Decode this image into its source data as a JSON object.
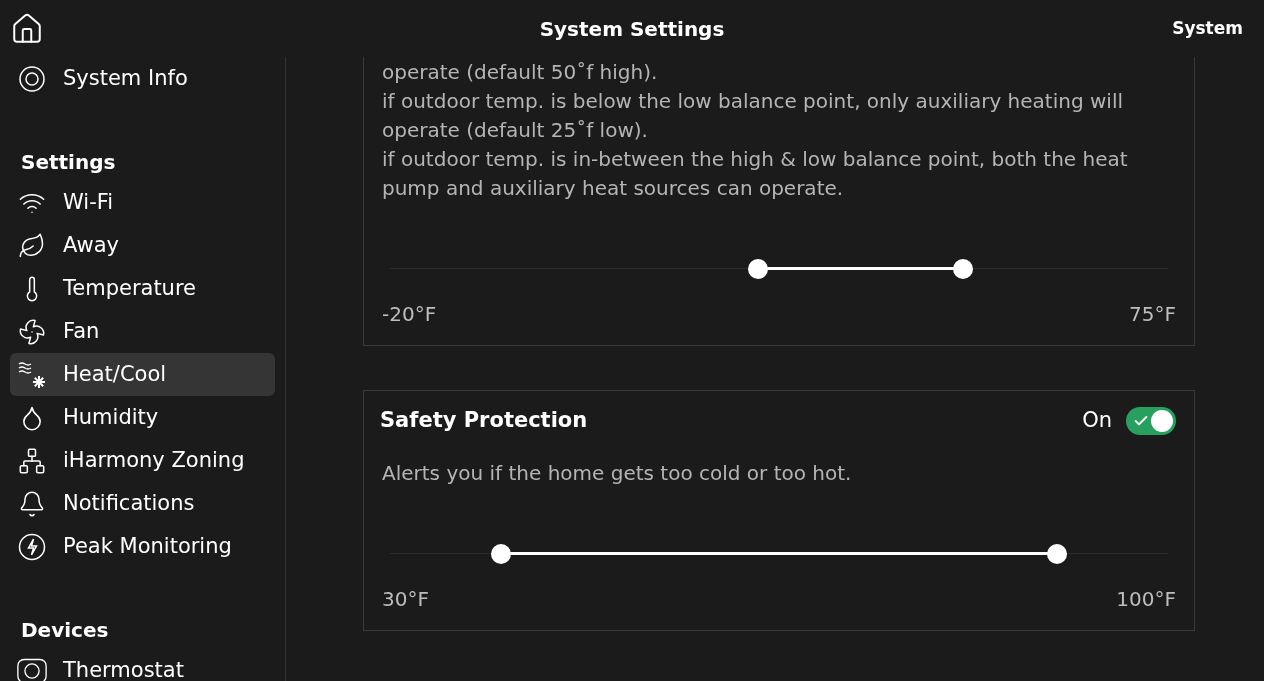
{
  "header": {
    "title": "System Settings",
    "context": "System"
  },
  "sidebar": {
    "top_items": [
      {
        "label": "System Info",
        "kind": "info",
        "selected": false
      }
    ],
    "sections": [
      {
        "title": "Settings",
        "items": [
          {
            "label": "Wi-Fi",
            "kind": "wifi",
            "selected": false
          },
          {
            "label": "Away",
            "kind": "away",
            "selected": false
          },
          {
            "label": "Temperature",
            "kind": "temperature",
            "selected": false
          },
          {
            "label": "Fan",
            "kind": "fan",
            "selected": false
          },
          {
            "label": "Heat/Cool",
            "kind": "heatcool",
            "selected": true
          },
          {
            "label": "Humidity",
            "kind": "humidity",
            "selected": false
          },
          {
            "label": "iHarmony Zoning",
            "kind": "zoning",
            "selected": false
          },
          {
            "label": "Notifications",
            "kind": "notifications",
            "selected": false
          },
          {
            "label": "Peak Monitoring",
            "kind": "peak",
            "selected": false
          }
        ]
      },
      {
        "title": "Devices",
        "items": [
          {
            "label": "Thermostat",
            "kind": "thermostat",
            "selected": false
          }
        ]
      }
    ]
  },
  "cards": [
    {
      "description": [
        "operate (default 50˚f high).",
        "if outdoor temp. is below the low balance point, only auxiliary heating will operate (default 25˚f low).",
        "if outdoor temp. is in-between the high & low balance point, both the heat pump and auxiliary heat sources can operate."
      ],
      "slider": {
        "low": {
          "level": 0.473
        },
        "high": {
          "level": 0.737
        },
        "min_label": "-20°F",
        "max_label": "75°F"
      }
    },
    {
      "title": "Safety Protection",
      "toggle": {
        "label": "On",
        "on": true
      },
      "description": [
        "Alerts you if the home gets too cold or too hot."
      ],
      "slider": {
        "low": {
          "level": 0.143
        },
        "high": {
          "level": 0.857
        },
        "min_label": "30°F",
        "max_label": "100°F"
      }
    }
  ]
}
